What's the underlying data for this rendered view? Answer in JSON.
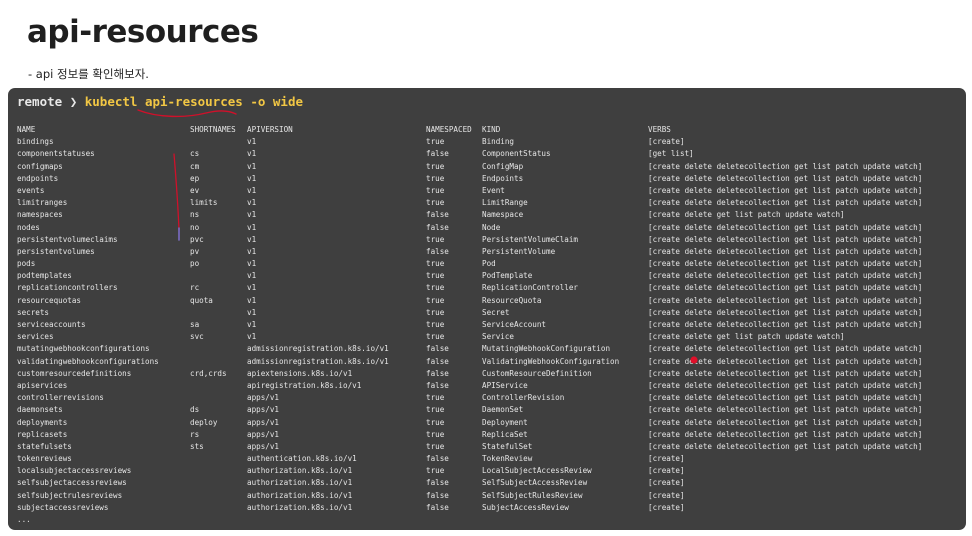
{
  "page": {
    "title": "api-resources",
    "intro": "- api 정보를 확인해보자."
  },
  "terminal": {
    "prompt": {
      "dir": "remote",
      "arrow": "❯",
      "command": "kubectl api-resources -o wide"
    },
    "headers": [
      "NAME",
      "SHORTNAMES",
      "APIVERSION",
      "NAMESPACED",
      "KIND",
      "VERBS"
    ],
    "rows": [
      [
        "bindings",
        "",
        "v1",
        "true",
        "Binding",
        "[create]"
      ],
      [
        "componentstatuses",
        "cs",
        "v1",
        "false",
        "ComponentStatus",
        "[get list]"
      ],
      [
        "configmaps",
        "cm",
        "v1",
        "true",
        "ConfigMap",
        "[create delete deletecollection get list patch update watch]"
      ],
      [
        "endpoints",
        "ep",
        "v1",
        "true",
        "Endpoints",
        "[create delete deletecollection get list patch update watch]"
      ],
      [
        "events",
        "ev",
        "v1",
        "true",
        "Event",
        "[create delete deletecollection get list patch update watch]"
      ],
      [
        "limitranges",
        "limits",
        "v1",
        "true",
        "LimitRange",
        "[create delete deletecollection get list patch update watch]"
      ],
      [
        "namespaces",
        "ns",
        "v1",
        "false",
        "Namespace",
        "[create delete get list patch update watch]"
      ],
      [
        "nodes",
        "no",
        "v1",
        "false",
        "Node",
        "[create delete deletecollection get list patch update watch]"
      ],
      [
        "persistentvolumeclaims",
        "pvc",
        "v1",
        "true",
        "PersistentVolumeClaim",
        "[create delete deletecollection get list patch update watch]"
      ],
      [
        "persistentvolumes",
        "pv",
        "v1",
        "false",
        "PersistentVolume",
        "[create delete deletecollection get list patch update watch]"
      ],
      [
        "pods",
        "po",
        "v1",
        "true",
        "Pod",
        "[create delete deletecollection get list patch update watch]"
      ],
      [
        "podtemplates",
        "",
        "v1",
        "true",
        "PodTemplate",
        "[create delete deletecollection get list patch update watch]"
      ],
      [
        "replicationcontrollers",
        "rc",
        "v1",
        "true",
        "ReplicationController",
        "[create delete deletecollection get list patch update watch]"
      ],
      [
        "resourcequotas",
        "quota",
        "v1",
        "true",
        "ResourceQuota",
        "[create delete deletecollection get list patch update watch]"
      ],
      [
        "secrets",
        "",
        "v1",
        "true",
        "Secret",
        "[create delete deletecollection get list patch update watch]"
      ],
      [
        "serviceaccounts",
        "sa",
        "v1",
        "true",
        "ServiceAccount",
        "[create delete deletecollection get list patch update watch]"
      ],
      [
        "services",
        "svc",
        "v1",
        "true",
        "Service",
        "[create delete get list patch update watch]"
      ],
      [
        "mutatingwebhookconfigurations",
        "",
        "admissionregistration.k8s.io/v1",
        "false",
        "MutatingWebhookConfiguration",
        "[create delete deletecollection get list patch update watch]"
      ],
      [
        "validatingwebhookconfigurations",
        "",
        "admissionregistration.k8s.io/v1",
        "false",
        "ValidatingWebhookConfiguration",
        "[create delete deletecollection get list patch update watch]"
      ],
      [
        "customresourcedefinitions",
        "crd,crds",
        "apiextensions.k8s.io/v1",
        "false",
        "CustomResourceDefinition",
        "[create delete deletecollection get list patch update watch]"
      ],
      [
        "apiservices",
        "",
        "apiregistration.k8s.io/v1",
        "false",
        "APIService",
        "[create delete deletecollection get list patch update watch]"
      ],
      [
        "controllerrevisions",
        "",
        "apps/v1",
        "true",
        "ControllerRevision",
        "[create delete deletecollection get list patch update watch]"
      ],
      [
        "daemonsets",
        "ds",
        "apps/v1",
        "true",
        "DaemonSet",
        "[create delete deletecollection get list patch update watch]"
      ],
      [
        "deployments",
        "deploy",
        "apps/v1",
        "true",
        "Deployment",
        "[create delete deletecollection get list patch update watch]"
      ],
      [
        "replicasets",
        "rs",
        "apps/v1",
        "true",
        "ReplicaSet",
        "[create delete deletecollection get list patch update watch]"
      ],
      [
        "statefulsets",
        "sts",
        "apps/v1",
        "true",
        "StatefulSet",
        "[create delete deletecollection get list patch update watch]"
      ],
      [
        "tokenreviews",
        "",
        "authentication.k8s.io/v1",
        "false",
        "TokenReview",
        "[create]"
      ],
      [
        "localsubjectaccessreviews",
        "",
        "authorization.k8s.io/v1",
        "true",
        "LocalSubjectAccessReview",
        "[create]"
      ],
      [
        "selfsubjectaccessreviews",
        "",
        "authorization.k8s.io/v1",
        "false",
        "SelfSubjectAccessReview",
        "[create]"
      ],
      [
        "selfsubjectrulesreviews",
        "",
        "authorization.k8s.io/v1",
        "false",
        "SelfSubjectRulesReview",
        "[create]"
      ],
      [
        "subjectaccessreviews",
        "",
        "authorization.k8s.io/v1",
        "false",
        "SubjectAccessReview",
        "[create]"
      ]
    ],
    "ellipsis": "...",
    "colors": {
      "background": "#3f3f3f",
      "text": "#e6e6e6",
      "command": "#f2c744",
      "annotation_red": "#d0102a",
      "annotation_purple": "#7a6cc4"
    }
  }
}
